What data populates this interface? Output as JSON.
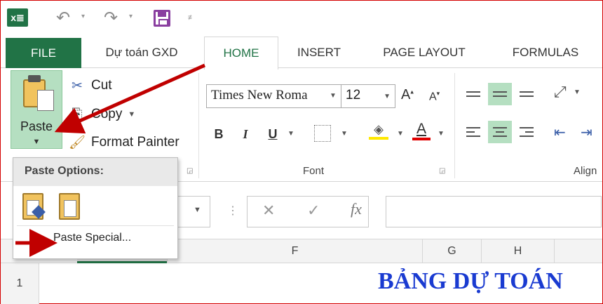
{
  "app": {
    "logo": "x≣"
  },
  "tabs": [
    "FILE",
    "Dự toán GXD",
    "HOME",
    "INSERT",
    "PAGE LAYOUT",
    "FORMULAS"
  ],
  "clipboard": {
    "paste_label": "Paste",
    "cut_label": "Cut",
    "copy_label": "Copy",
    "format_painter_label": "Format Painter"
  },
  "font": {
    "name": "Times New Roma",
    "size": "12",
    "group_label": "Font",
    "bold": "B",
    "italic": "I",
    "underline": "U",
    "font_color_glyph": "A",
    "grow_glyph": "A",
    "shrink_glyph": "A"
  },
  "alignment": {
    "group_label": "Align"
  },
  "paste_menu": {
    "header": "Paste Options:",
    "paste_special": "Paste Special..."
  },
  "formula_bar": {
    "fx": "fx"
  },
  "columns": [
    "F",
    "G",
    "H"
  ],
  "rows": [
    "1"
  ],
  "cell_title": "BẢNG DỰ TOÁN",
  "colors": {
    "excel_green": "#217346",
    "paste_highlight": "#b5dfc1",
    "arrow_red": "#c00000",
    "title_blue": "#1a3bd1"
  }
}
